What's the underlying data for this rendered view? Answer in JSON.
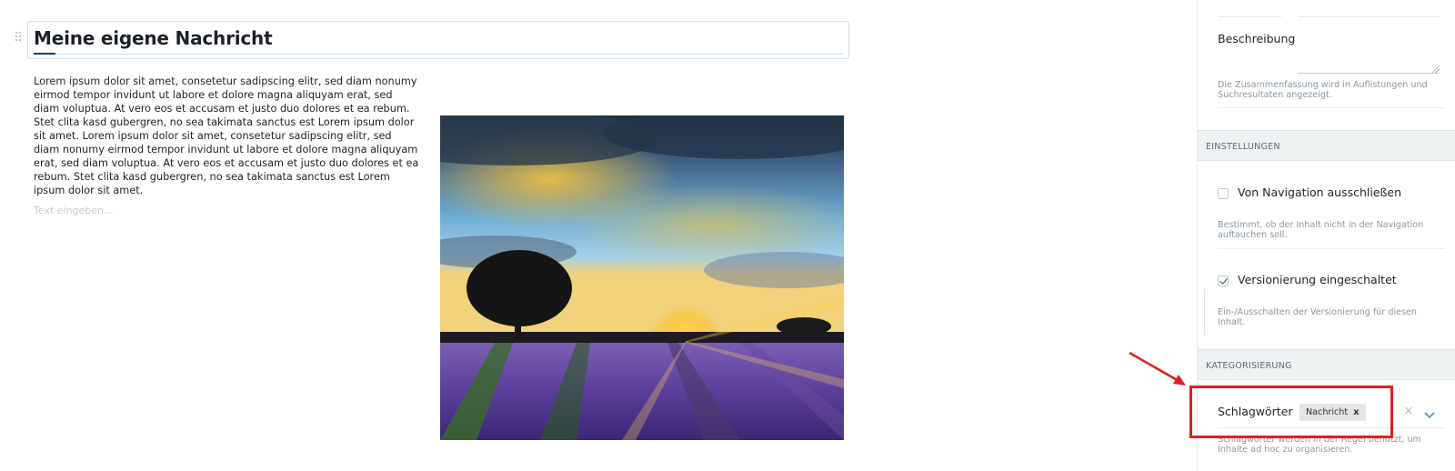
{
  "editor": {
    "title": "Meine eigene Nachricht",
    "body": "Lorem ipsum dolor sit amet, consetetur sadipscing elitr, sed diam nonumy eirmod tempor invidunt ut labore et dolore magna aliquyam erat, sed diam voluptua. At vero eos et accusam et justo duo dolores et ea rebum. Stet clita kasd gubergren, no sea takimata sanctus est Lorem ipsum dolor sit amet. Lorem ipsum dolor sit amet, consetetur sadipscing elitr, sed diam nonumy eirmod tempor invidunt ut labore et dolore magna aliquyam erat, sed diam voluptua. At vero eos et accusam et justo duo dolores et ea rebum. Stet clita kasd gubergren, no sea takimata sanctus est Lorem ipsum dolor sit amet.",
    "text_placeholder": "Text eingeben..."
  },
  "sidebar": {
    "description": {
      "label": "Beschreibung",
      "help": "Die Zusammenfassung wird in Auflistungen und Suchresultaten angezeigt."
    },
    "settings": {
      "header": "EINSTELLUNGEN",
      "exclude_nav": {
        "label": "Von Navigation ausschließen",
        "checked": false,
        "help": "Bestimmt, ob der Inhalt nicht in der Navigation auftauchen soll."
      },
      "versioning": {
        "label": "Versionierung eingeschaltet",
        "checked": true,
        "help": "Ein-/Ausschalten der Versionierung für diesen Inhalt."
      }
    },
    "categorization": {
      "header": "KATEGORISIERUNG",
      "tags_label": "Schlagwörter",
      "tags": [
        "Nachricht"
      ],
      "tag_remove": "x",
      "clear": "×",
      "help": "Schlagwörter werden in der Regel benutzt, um Inhalte ad hoc zu organisieren."
    }
  },
  "colors": {
    "accent": "#1c3c78",
    "highlight": "#e01e24",
    "section_bg": "#eef2f3"
  },
  "icons": {
    "drag": "drag-handle-icon",
    "check": "checkmark-icon",
    "chevron": "chevron-down-icon",
    "clear": "close-icon"
  }
}
